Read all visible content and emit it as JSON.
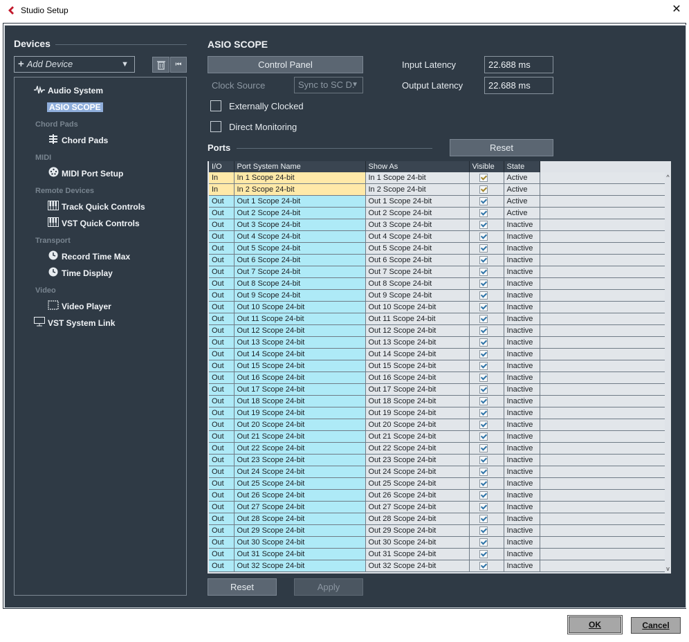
{
  "window": {
    "title": "Studio Setup"
  },
  "devices": {
    "heading": "Devices",
    "add_device": "Add Device",
    "tree": [
      {
        "type": "item",
        "label": "Audio System",
        "icon": "waveform-icon"
      },
      {
        "type": "selected",
        "label": "ASIO SCOPE"
      },
      {
        "type": "category",
        "label": "Chord Pads"
      },
      {
        "type": "item",
        "label": "Chord Pads",
        "icon": "chord-pads-icon"
      },
      {
        "type": "category",
        "label": "MIDI"
      },
      {
        "type": "item",
        "label": "MIDI Port Setup",
        "icon": "midi-icon"
      },
      {
        "type": "category",
        "label": "Remote Devices"
      },
      {
        "type": "item",
        "label": "Track Quick Controls",
        "icon": "keyboard-icon"
      },
      {
        "type": "item",
        "label": "VST Quick Controls",
        "icon": "keyboard-icon"
      },
      {
        "type": "category",
        "label": "Transport"
      },
      {
        "type": "item",
        "label": "Record Time Max",
        "icon": "clock-icon"
      },
      {
        "type": "item",
        "label": "Time Display",
        "icon": "clock-icon"
      },
      {
        "type": "category",
        "label": "Video"
      },
      {
        "type": "item",
        "label": "Video Player",
        "icon": "video-icon"
      },
      {
        "type": "item",
        "label": "VST System Link",
        "icon": "monitor-icon"
      }
    ]
  },
  "asio": {
    "heading": "ASIO SCOPE",
    "control_panel": "Control Panel",
    "clock_source_label": "Clock Source",
    "clock_source_value": "Sync to SC D.",
    "externally_clocked": "Externally Clocked",
    "direct_monitoring": "Direct Monitoring",
    "input_latency_label": "Input Latency",
    "input_latency": "22.688 ms",
    "output_latency_label": "Output Latency",
    "output_latency": "22.688 ms"
  },
  "ports": {
    "heading": "Ports",
    "reset": "Reset",
    "columns": [
      "I/O",
      "Port System Name",
      "Show As",
      "Visible",
      "State"
    ],
    "rows": [
      [
        "In",
        "In 1 Scope 24-bit",
        "In 1 Scope 24-bit",
        "Active"
      ],
      [
        "In",
        "In 2 Scope 24-bit",
        "In 2 Scope 24-bit",
        "Active"
      ],
      [
        "Out",
        "Out 1 Scope 24-bit",
        "Out 1 Scope 24-bit",
        "Active"
      ],
      [
        "Out",
        "Out 2 Scope 24-bit",
        "Out 2 Scope 24-bit",
        "Active"
      ],
      [
        "Out",
        "Out 3 Scope 24-bit",
        "Out 3 Scope 24-bit",
        "Inactive"
      ],
      [
        "Out",
        "Out 4 Scope 24-bit",
        "Out 4 Scope 24-bit",
        "Inactive"
      ],
      [
        "Out",
        "Out 5 Scope 24-bit",
        "Out 5 Scope 24-bit",
        "Inactive"
      ],
      [
        "Out",
        "Out 6 Scope 24-bit",
        "Out 6 Scope 24-bit",
        "Inactive"
      ],
      [
        "Out",
        "Out 7 Scope 24-bit",
        "Out 7 Scope 24-bit",
        "Inactive"
      ],
      [
        "Out",
        "Out 8 Scope 24-bit",
        "Out 8 Scope 24-bit",
        "Inactive"
      ],
      [
        "Out",
        "Out 9 Scope 24-bit",
        "Out 9 Scope 24-bit",
        "Inactive"
      ],
      [
        "Out",
        "Out 10 Scope 24-bit",
        "Out 10 Scope 24-bit",
        "Inactive"
      ],
      [
        "Out",
        "Out 11 Scope 24-bit",
        "Out 11 Scope 24-bit",
        "Inactive"
      ],
      [
        "Out",
        "Out 12 Scope 24-bit",
        "Out 12 Scope 24-bit",
        "Inactive"
      ],
      [
        "Out",
        "Out 13 Scope 24-bit",
        "Out 13 Scope 24-bit",
        "Inactive"
      ],
      [
        "Out",
        "Out 14 Scope 24-bit",
        "Out 14 Scope 24-bit",
        "Inactive"
      ],
      [
        "Out",
        "Out 15 Scope 24-bit",
        "Out 15 Scope 24-bit",
        "Inactive"
      ],
      [
        "Out",
        "Out 16 Scope 24-bit",
        "Out 16 Scope 24-bit",
        "Inactive"
      ],
      [
        "Out",
        "Out 17 Scope 24-bit",
        "Out 17 Scope 24-bit",
        "Inactive"
      ],
      [
        "Out",
        "Out 18 Scope 24-bit",
        "Out 18 Scope 24-bit",
        "Inactive"
      ],
      [
        "Out",
        "Out 19 Scope 24-bit",
        "Out 19 Scope 24-bit",
        "Inactive"
      ],
      [
        "Out",
        "Out 20 Scope 24-bit",
        "Out 20 Scope 24-bit",
        "Inactive"
      ],
      [
        "Out",
        "Out 21 Scope 24-bit",
        "Out 21 Scope 24-bit",
        "Inactive"
      ],
      [
        "Out",
        "Out 22 Scope 24-bit",
        "Out 22 Scope 24-bit",
        "Inactive"
      ],
      [
        "Out",
        "Out 23 Scope 24-bit",
        "Out 23 Scope 24-bit",
        "Inactive"
      ],
      [
        "Out",
        "Out 24 Scope 24-bit",
        "Out 24 Scope 24-bit",
        "Inactive"
      ],
      [
        "Out",
        "Out 25 Scope 24-bit",
        "Out 25 Scope 24-bit",
        "Inactive"
      ],
      [
        "Out",
        "Out 26 Scope 24-bit",
        "Out 26 Scope 24-bit",
        "Inactive"
      ],
      [
        "Out",
        "Out 27 Scope 24-bit",
        "Out 27 Scope 24-bit",
        "Inactive"
      ],
      [
        "Out",
        "Out 28 Scope 24-bit",
        "Out 28 Scope 24-bit",
        "Inactive"
      ],
      [
        "Out",
        "Out 29 Scope 24-bit",
        "Out 29 Scope 24-bit",
        "Inactive"
      ],
      [
        "Out",
        "Out 30 Scope 24-bit",
        "Out 30 Scope 24-bit",
        "Inactive"
      ],
      [
        "Out",
        "Out 31 Scope 24-bit",
        "Out 31 Scope 24-bit",
        "Inactive"
      ],
      [
        "Out",
        "Out 32 Scope 24-bit",
        "Out 32 Scope 24-bit",
        "Inactive"
      ]
    ],
    "reset_bottom": "Reset",
    "apply": "Apply"
  },
  "dialog": {
    "ok": "OK",
    "cancel": "Cancel"
  },
  "colors": {
    "panel": "#2f3a45",
    "in_row": "#ffe9a8",
    "out_row": "#aeeaf7",
    "selection": "#8faedb"
  }
}
